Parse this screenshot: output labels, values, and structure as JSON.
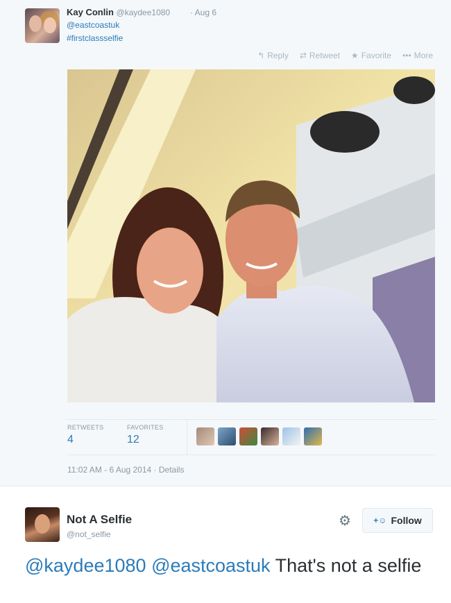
{
  "tweet1": {
    "name": "Kay Conlin",
    "handle": "@kaydee1080",
    "date": "· Aug 6",
    "mention": "@eastcoastuk",
    "hashtag": "#firstclassselfie",
    "actions": {
      "reply": "Reply",
      "retweet": "Retweet",
      "favorite": "Favorite",
      "more": "More"
    },
    "stats": {
      "retweets_label": "RETWEETS",
      "retweets": "4",
      "favorites_label": "FAVORITES",
      "favorites": "12"
    },
    "timestamp": "11:02 AM - 6 Aug 2014",
    "details": "· Details"
  },
  "tweet2": {
    "name": "Not A Selfie",
    "handle": "@not_selfie",
    "follow_label": "Follow",
    "mention1": "@kaydee1080",
    "mention2": "@eastcoastuk",
    "text": "That's not a selfie"
  },
  "colors": {
    "link": "#2b7bb9",
    "muted": "#8899a6",
    "background": "#f5f8fa"
  },
  "icons": {
    "reply": "reply-icon",
    "retweet": "retweet-icon",
    "favorite": "star-icon",
    "more": "more-icon",
    "gear": "gear-icon",
    "follow": "add-user-icon"
  }
}
